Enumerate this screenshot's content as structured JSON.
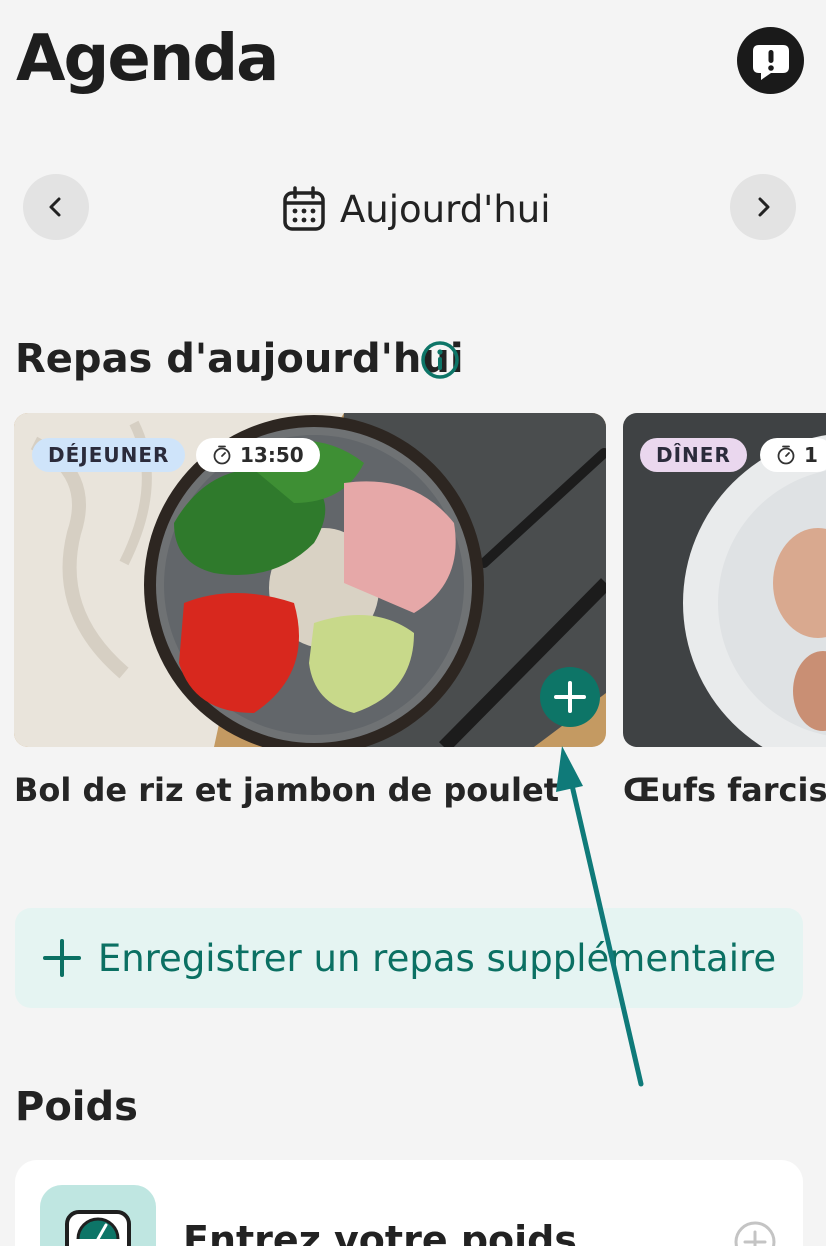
{
  "header": {
    "title": "Agenda"
  },
  "date_nav": {
    "label": "Aujourd'hui"
  },
  "meals_section": {
    "title": "Repas d'aujourd'hui",
    "meals": [
      {
        "type": "DÉJEUNER",
        "time": "13:50",
        "name": "Bol de riz et jambon de poulet"
      },
      {
        "type": "DÎNER",
        "time": "1",
        "name": "Œufs farcis"
      }
    ]
  },
  "extra_meal": {
    "label": "Enregistrer un repas supplémentaire"
  },
  "weight_section": {
    "title": "Poids",
    "entry_label": "Entrez votre poids"
  },
  "colors": {
    "accent": "#0d7567",
    "background": "#f4f4f4",
    "lunch_badge": "#cfe4fa",
    "dinner_badge": "#ead7ee"
  }
}
